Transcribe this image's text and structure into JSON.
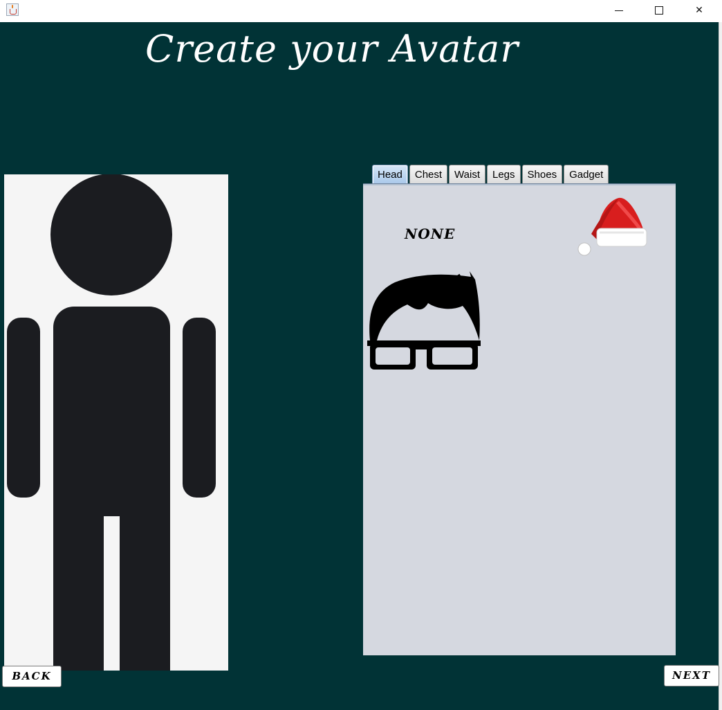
{
  "window": {
    "app_icon": "java-cup-icon",
    "controls": [
      "minimize-icon",
      "maximize-icon",
      "close-icon"
    ]
  },
  "page": {
    "title": "Create your Avatar"
  },
  "avatar_preview": {
    "icon": "person-silhouette-icon"
  },
  "tabs": [
    {
      "label": "Head",
      "active": true
    },
    {
      "label": "Chest",
      "active": false
    },
    {
      "label": "Waist",
      "active": false
    },
    {
      "label": "Legs",
      "active": false
    },
    {
      "label": "Shoes",
      "active": false
    },
    {
      "label": "Gadget",
      "active": false
    }
  ],
  "head_options": {
    "none_label": "NONE",
    "items": [
      "santa-hat-icon",
      "hair-and-glasses-icon"
    ]
  },
  "navigation": {
    "back_label": "BACK",
    "next_label": "NEXT"
  },
  "colors": {
    "background": "#013336",
    "panel": "#d5d8e0",
    "silhouette": "#1b1c20",
    "hat_red": "#d81e1e"
  }
}
